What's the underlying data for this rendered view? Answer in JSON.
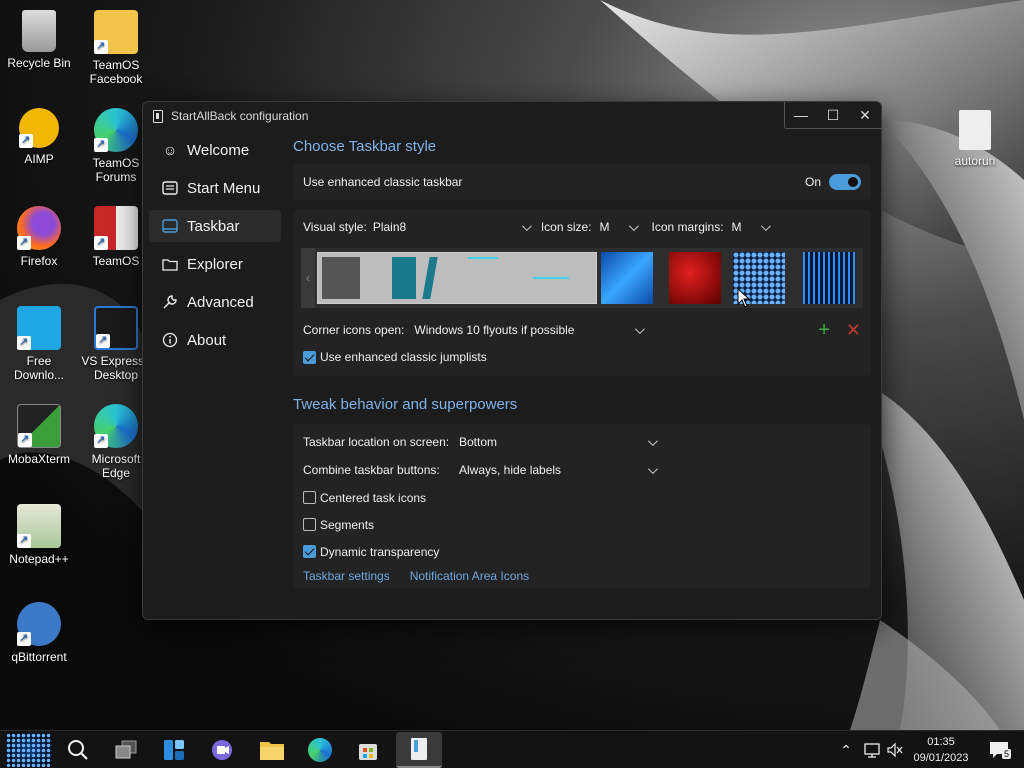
{
  "desktop": {
    "icons": [
      {
        "label": "Recycle Bin"
      },
      {
        "label": "TeamOS Facebook"
      },
      {
        "label": "AIMP"
      },
      {
        "label": "TeamOS Forums"
      },
      {
        "label": "Firefox"
      },
      {
        "label": "TeamOS"
      },
      {
        "label": "Free Downlo..."
      },
      {
        "label": "VS Express f Desktop"
      },
      {
        "label": "MobaXterm"
      },
      {
        "label": "Microsoft Edge"
      },
      {
        "label": "Notepad++"
      },
      {
        "label": "qBittorrent"
      },
      {
        "label": "autorun"
      }
    ]
  },
  "window": {
    "title": "StartAllBack configuration",
    "controls": {
      "minimize": "—",
      "maximize": "☐",
      "close": "✕"
    }
  },
  "sidebar": {
    "items": [
      {
        "label": "Welcome",
        "icon": "smile-icon"
      },
      {
        "label": "Start Menu",
        "icon": "start-menu-icon"
      },
      {
        "label": "Taskbar",
        "icon": "taskbar-icon",
        "active": true
      },
      {
        "label": "Explorer",
        "icon": "folder-icon"
      },
      {
        "label": "Advanced",
        "icon": "wrench-icon"
      },
      {
        "label": "About",
        "icon": "info-icon"
      }
    ]
  },
  "style_section": {
    "title": "Choose Taskbar style",
    "enhanced_label": "Use enhanced classic taskbar",
    "enhanced_state": "On",
    "visual_style_label": "Visual style:",
    "visual_style_value": "Plain8",
    "icon_size_label": "Icon size:",
    "icon_size_value": "M",
    "icon_margins_label": "Icon margins:",
    "icon_margins_value": "M",
    "corner_icons_label": "Corner icons open:",
    "corner_icons_value": "Windows 10 flyouts if possible",
    "jumplists_label": "Use enhanced classic jumplists",
    "jumplists_checked": true
  },
  "tweak_section": {
    "title": "Tweak behavior and superpowers",
    "location_label": "Taskbar location on screen:",
    "location_value": "Bottom",
    "combine_label": "Combine taskbar buttons:",
    "combine_value": "Always, hide labels",
    "centered_label": "Centered task icons",
    "segments_label": "Segments",
    "dynamic_label": "Dynamic transparency",
    "link_taskbar_settings": "Taskbar settings",
    "link_notification_icons": "Notification Area Icons"
  },
  "taskbar": {
    "time": "01:35",
    "date": "09/01/2023",
    "notification_count": "5"
  },
  "colors": {
    "accent": "#4a9bd9",
    "section_title": "#7fb3e8",
    "add_green": "#3fae3f",
    "remove_red": "#c0392b"
  }
}
